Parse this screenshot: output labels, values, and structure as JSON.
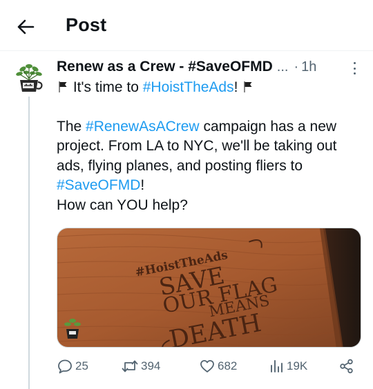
{
  "header": {
    "back_icon": "arrow-left-icon",
    "title": "Post"
  },
  "tweet": {
    "author_name": "Renew as a Crew - #SaveOFMD",
    "name_truncation": "...",
    "separator": "·",
    "timestamp": "1h",
    "more_icon": "more-vertical-icon",
    "flag_icon": "black-flag-icon",
    "line1_before": "It's time to ",
    "line1_hashtag": "#HoistTheAds",
    "line1_after": "!",
    "p2_text1": "The ",
    "p2_hashtag1": "#RenewAsACrew",
    "p2_text2": " campaign has a new project. From LA to NYC, we'll be taking out ads, flying planes, and posting fliers to ",
    "p2_hashtag2": "#SaveOFMD",
    "p2_text3": "!",
    "p3": "How can YOU help?",
    "media": {
      "engraved_tag": "#HoistTheAds",
      "engraved_line1": "SAVE",
      "engraved_line2": "OUR FLAG",
      "engraved_line3": "MEANS",
      "engraved_line4": "DEATH"
    }
  },
  "actions": {
    "reply": {
      "icon": "reply-icon",
      "count": "25"
    },
    "repost": {
      "icon": "repost-icon",
      "count": "394"
    },
    "like": {
      "icon": "heart-icon",
      "count": "682"
    },
    "views": {
      "icon": "views-icon",
      "count": "19K"
    },
    "share": {
      "icon": "share-icon"
    }
  },
  "colors": {
    "link": "#1d9bf0",
    "secondary_text": "#536471",
    "primary_text": "#0f1419"
  }
}
